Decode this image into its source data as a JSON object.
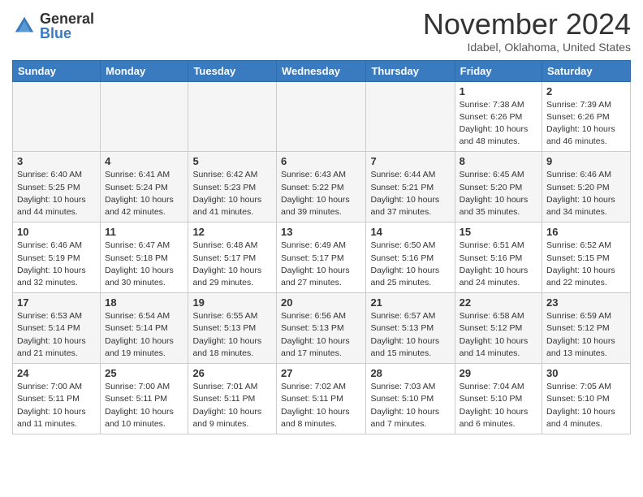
{
  "header": {
    "logo_general": "General",
    "logo_blue": "Blue",
    "month_title": "November 2024",
    "location": "Idabel, Oklahoma, United States"
  },
  "days_of_week": [
    "Sunday",
    "Monday",
    "Tuesday",
    "Wednesday",
    "Thursday",
    "Friday",
    "Saturday"
  ],
  "weeks": [
    [
      {
        "num": "",
        "info": "",
        "empty": true
      },
      {
        "num": "",
        "info": "",
        "empty": true
      },
      {
        "num": "",
        "info": "",
        "empty": true
      },
      {
        "num": "",
        "info": "",
        "empty": true
      },
      {
        "num": "",
        "info": "",
        "empty": true
      },
      {
        "num": "1",
        "info": "Sunrise: 7:38 AM\nSunset: 6:26 PM\nDaylight: 10 hours\nand 48 minutes.",
        "empty": false
      },
      {
        "num": "2",
        "info": "Sunrise: 7:39 AM\nSunset: 6:26 PM\nDaylight: 10 hours\nand 46 minutes.",
        "empty": false
      }
    ],
    [
      {
        "num": "3",
        "info": "Sunrise: 6:40 AM\nSunset: 5:25 PM\nDaylight: 10 hours\nand 44 minutes.",
        "empty": false
      },
      {
        "num": "4",
        "info": "Sunrise: 6:41 AM\nSunset: 5:24 PM\nDaylight: 10 hours\nand 42 minutes.",
        "empty": false
      },
      {
        "num": "5",
        "info": "Sunrise: 6:42 AM\nSunset: 5:23 PM\nDaylight: 10 hours\nand 41 minutes.",
        "empty": false
      },
      {
        "num": "6",
        "info": "Sunrise: 6:43 AM\nSunset: 5:22 PM\nDaylight: 10 hours\nand 39 minutes.",
        "empty": false
      },
      {
        "num": "7",
        "info": "Sunrise: 6:44 AM\nSunset: 5:21 PM\nDaylight: 10 hours\nand 37 minutes.",
        "empty": false
      },
      {
        "num": "8",
        "info": "Sunrise: 6:45 AM\nSunset: 5:20 PM\nDaylight: 10 hours\nand 35 minutes.",
        "empty": false
      },
      {
        "num": "9",
        "info": "Sunrise: 6:46 AM\nSunset: 5:20 PM\nDaylight: 10 hours\nand 34 minutes.",
        "empty": false
      }
    ],
    [
      {
        "num": "10",
        "info": "Sunrise: 6:46 AM\nSunset: 5:19 PM\nDaylight: 10 hours\nand 32 minutes.",
        "empty": false
      },
      {
        "num": "11",
        "info": "Sunrise: 6:47 AM\nSunset: 5:18 PM\nDaylight: 10 hours\nand 30 minutes.",
        "empty": false
      },
      {
        "num": "12",
        "info": "Sunrise: 6:48 AM\nSunset: 5:17 PM\nDaylight: 10 hours\nand 29 minutes.",
        "empty": false
      },
      {
        "num": "13",
        "info": "Sunrise: 6:49 AM\nSunset: 5:17 PM\nDaylight: 10 hours\nand 27 minutes.",
        "empty": false
      },
      {
        "num": "14",
        "info": "Sunrise: 6:50 AM\nSunset: 5:16 PM\nDaylight: 10 hours\nand 25 minutes.",
        "empty": false
      },
      {
        "num": "15",
        "info": "Sunrise: 6:51 AM\nSunset: 5:16 PM\nDaylight: 10 hours\nand 24 minutes.",
        "empty": false
      },
      {
        "num": "16",
        "info": "Sunrise: 6:52 AM\nSunset: 5:15 PM\nDaylight: 10 hours\nand 22 minutes.",
        "empty": false
      }
    ],
    [
      {
        "num": "17",
        "info": "Sunrise: 6:53 AM\nSunset: 5:14 PM\nDaylight: 10 hours\nand 21 minutes.",
        "empty": false
      },
      {
        "num": "18",
        "info": "Sunrise: 6:54 AM\nSunset: 5:14 PM\nDaylight: 10 hours\nand 19 minutes.",
        "empty": false
      },
      {
        "num": "19",
        "info": "Sunrise: 6:55 AM\nSunset: 5:13 PM\nDaylight: 10 hours\nand 18 minutes.",
        "empty": false
      },
      {
        "num": "20",
        "info": "Sunrise: 6:56 AM\nSunset: 5:13 PM\nDaylight: 10 hours\nand 17 minutes.",
        "empty": false
      },
      {
        "num": "21",
        "info": "Sunrise: 6:57 AM\nSunset: 5:13 PM\nDaylight: 10 hours\nand 15 minutes.",
        "empty": false
      },
      {
        "num": "22",
        "info": "Sunrise: 6:58 AM\nSunset: 5:12 PM\nDaylight: 10 hours\nand 14 minutes.",
        "empty": false
      },
      {
        "num": "23",
        "info": "Sunrise: 6:59 AM\nSunset: 5:12 PM\nDaylight: 10 hours\nand 13 minutes.",
        "empty": false
      }
    ],
    [
      {
        "num": "24",
        "info": "Sunrise: 7:00 AM\nSunset: 5:11 PM\nDaylight: 10 hours\nand 11 minutes.",
        "empty": false
      },
      {
        "num": "25",
        "info": "Sunrise: 7:00 AM\nSunset: 5:11 PM\nDaylight: 10 hours\nand 10 minutes.",
        "empty": false
      },
      {
        "num": "26",
        "info": "Sunrise: 7:01 AM\nSunset: 5:11 PM\nDaylight: 10 hours\nand 9 minutes.",
        "empty": false
      },
      {
        "num": "27",
        "info": "Sunrise: 7:02 AM\nSunset: 5:11 PM\nDaylight: 10 hours\nand 8 minutes.",
        "empty": false
      },
      {
        "num": "28",
        "info": "Sunrise: 7:03 AM\nSunset: 5:10 PM\nDaylight: 10 hours\nand 7 minutes.",
        "empty": false
      },
      {
        "num": "29",
        "info": "Sunrise: 7:04 AM\nSunset: 5:10 PM\nDaylight: 10 hours\nand 6 minutes.",
        "empty": false
      },
      {
        "num": "30",
        "info": "Sunrise: 7:05 AM\nSunset: 5:10 PM\nDaylight: 10 hours\nand 4 minutes.",
        "empty": false
      }
    ]
  ]
}
